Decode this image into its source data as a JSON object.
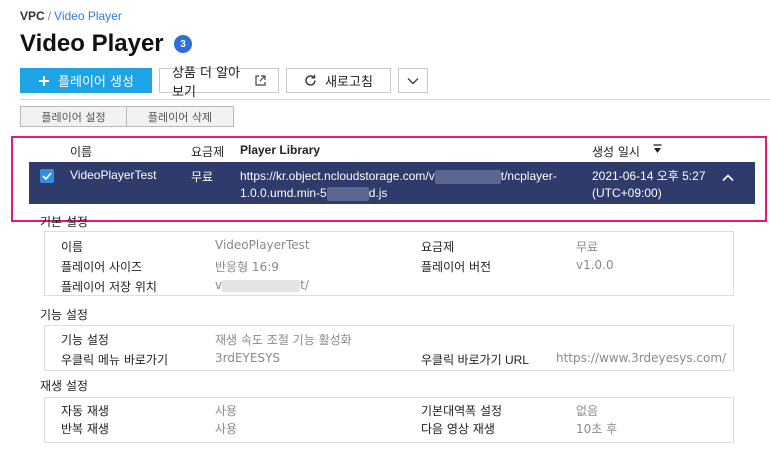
{
  "breadcrumb": {
    "root": "VPC",
    "separator": "/",
    "current": "Video Player"
  },
  "page": {
    "title": "Video Player",
    "badge": "3"
  },
  "toolbar": {
    "create_label": "플레이어 생성",
    "learn_label": "상품 더 알아보기",
    "refresh_label": "새로고침"
  },
  "subtabs": {
    "settings": "플레이어 설정",
    "delete": "플레이어 삭제"
  },
  "table": {
    "headers": {
      "name": "이름",
      "plan": "요금제",
      "library": "Player Library",
      "created": "생성 일시"
    },
    "row": {
      "name": "VideoPlayerTest",
      "plan": "무료",
      "library_part1": "https://kr.object.ncloudstorage.com/v",
      "library_part2": "t/ncplayer-",
      "library_part3": "1.0.0.umd.min-5",
      "library_part4": "d.js",
      "created_line1": "2021-06-14 오후 5:27",
      "created_line2": "(UTC+09:00)"
    }
  },
  "basic_settings": {
    "title": "기본 설정",
    "name_label": "이름",
    "name_value": "VideoPlayerTest",
    "plan_label": "요금제",
    "plan_value": "무료",
    "size_label": "플레이어 사이즈",
    "size_value": "반응형 16:9",
    "version_label": "플레이어 버전",
    "version_value": "v1.0.0",
    "storage_label": "플레이어 저장 위치",
    "storage_value_start": "v",
    "storage_value_end": "t/"
  },
  "feature_settings": {
    "title": "기능 설정",
    "feature_label": "기능 설정",
    "feature_value": "재생 속도 조절 기능 활성화",
    "menu_label": "우클릭 메뉴 바로가기",
    "menu_value": "3rdEYESYS",
    "url_label": "우클릭 바로가기 URL",
    "url_value": "https://www.3rdeyesys.com/"
  },
  "playback_settings": {
    "title": "재생 설정",
    "autoplay_label": "자동 재생",
    "autoplay_value": "사용",
    "bandwidth_label": "기본대역폭 설정",
    "bandwidth_value": "없음",
    "repeat_label": "반복 재생",
    "repeat_value": "사용",
    "next_label": "다음 영상 재생",
    "next_value": "10초 후"
  },
  "colors": {
    "primary_button": "#1ea3e5",
    "selected_row": "#2f3b6b",
    "highlight_border": "#e5177b",
    "badge": "#2e6ed6",
    "breadcrumb_link": "#2e7cd6"
  },
  "icons": [
    "plus-icon",
    "external-link-icon",
    "refresh-icon",
    "chevron-down-icon",
    "sort-desc-icon",
    "check-icon",
    "chevron-up-icon"
  ]
}
